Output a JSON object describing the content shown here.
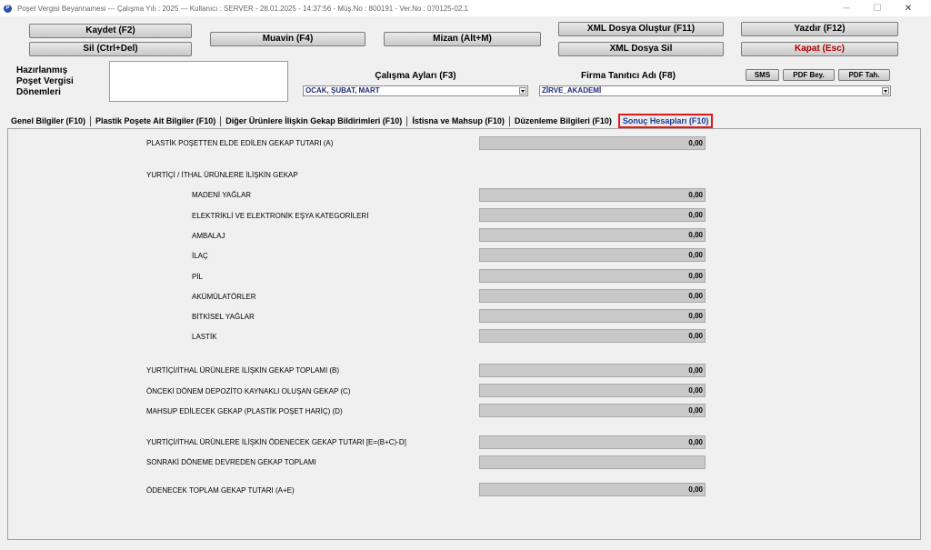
{
  "window": {
    "title": "Poşet Vergisi Beyannamesi  ---  Çalışma Yılı : 2025  ---  Kullanıcı : SERVER - 28.01.2025 - 14:37:56 - Müş.No : 800191 - Ver.No : 070125-02.1",
    "controls": {
      "minimize": "─",
      "maximize": "☐",
      "close": "✕"
    }
  },
  "toolbar": {
    "save": "Kaydet (F2)",
    "delete": "Sil (Ctrl+Del)",
    "muavin": "Muavin (F4)",
    "mizan": "Mizan (Alt+M)",
    "xml_create": "XML Dosya Oluştur (F11)",
    "xml_delete": "XML Dosya Sil",
    "print": "Yazdır (F12)",
    "close": "Kapat (Esc)"
  },
  "periods": {
    "label": "Hazırlanmış Poşet Vergisi Dönemleri",
    "label_lines": [
      "Hazırlanmış",
      "Poşet Vergisi",
      "Dönemleri"
    ]
  },
  "working_months": {
    "label": "Çalışma Ayları (F3)",
    "value": "OCAK, ŞUBAT, MART"
  },
  "company": {
    "label": "Firma Tanıtıcı Adı (F8)",
    "value": "ZİRVE_AKADEMİ"
  },
  "small_buttons": {
    "sms": "SMS",
    "pdf_bey": "PDF Bey.",
    "pdf_tah": "PDF Tah."
  },
  "tabs": [
    "Genel Bilgiler (F10)",
    "Plastik Poşete Ait Bilgiler (F10)",
    "Diğer Ürünlere İlişkin Gekap Bildirimleri (F10)",
    "İstisna ve Mahsup (F10)",
    "Düzenleme Bilgileri (F10)",
    "Sonuç Hesapları (F10)"
  ],
  "results": {
    "a": {
      "label": "PLASTİK POŞETTEN ELDE EDİLEN GEKAP TUTARI (A)",
      "value": "0,00"
    },
    "domestic_heading": "YURTİÇİ / İTHAL ÜRÜNLERE İLİŞKİN GEKAP",
    "items": [
      {
        "label": "MADENİ YAĞLAR",
        "value": "0,00"
      },
      {
        "label": "ELEKTRİKLİ VE ELEKTRONİK EŞYA KATEGORİLERİ",
        "value": "0,00"
      },
      {
        "label": "AMBALAJ",
        "value": "0,00"
      },
      {
        "label": "İLAÇ",
        "value": "0,00"
      },
      {
        "label": "PİL",
        "value": "0,00"
      },
      {
        "label": "AKÜMÜLATÖRLER",
        "value": "0,00"
      },
      {
        "label": "BİTKİSEL YAĞLAR",
        "value": "0,00"
      },
      {
        "label": "LASTİK",
        "value": "0,00"
      }
    ],
    "b": {
      "label": "YURTİÇİ/İTHAL ÜRÜNLERE İLİŞKİN GEKAP TOPLAMI (B)",
      "value": "0,00"
    },
    "c": {
      "label": "ÖNCEKİ DÖNEM DEPOZİTO KAYNAKLI OLUŞAN GEKAP (C)",
      "value": "0,00"
    },
    "d": {
      "label": "MAHSUP EDİLECEK GEKAP (PLASTİK POŞET HARİÇ) (D)",
      "value": "0,00"
    },
    "e": {
      "label": "YURTİÇİ/İTHAL ÜRÜNLERE İLİŞKİN ÖDENECEK GEKAP TUTARI [E=(B+C)-D]",
      "value": "0,00"
    },
    "carry": {
      "label": "SONRAKİ DÖNEME DEVREDEN GEKAP TOPLAMI",
      "value": ""
    },
    "total": {
      "label": "ÖDENECEK TOPLAM GEKAP TUTARI (A+E)",
      "value": "0,00"
    }
  }
}
